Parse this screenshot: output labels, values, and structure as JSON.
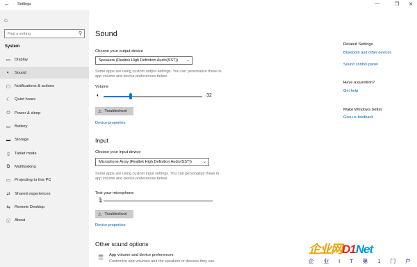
{
  "window": {
    "title": "Settings",
    "minimize": "—",
    "maximize": "❐",
    "close": "✕"
  },
  "sidebar": {
    "search_placeholder": "Find a setting",
    "section_label": "System",
    "items": [
      {
        "label": "Display",
        "icon": "display-icon",
        "glyph": "▭"
      },
      {
        "label": "Sound",
        "icon": "speaker-icon",
        "glyph": "🔈︎"
      },
      {
        "label": "Notifications & actions",
        "icon": "notifications-icon",
        "glyph": "▢"
      },
      {
        "label": "Quiet hours",
        "icon": "moon-icon",
        "glyph": "☾"
      },
      {
        "label": "Power & sleep",
        "icon": "power-icon",
        "glyph": "⏻"
      },
      {
        "label": "Battery",
        "icon": "battery-icon",
        "glyph": "▭"
      },
      {
        "label": "Storage",
        "icon": "storage-icon",
        "glyph": "▬"
      },
      {
        "label": "Tablet mode",
        "icon": "tablet-icon",
        "glyph": "▯"
      },
      {
        "label": "Multitasking",
        "icon": "multitasking-icon",
        "glyph": "⧉"
      },
      {
        "label": "Projecting to this PC",
        "icon": "projecting-icon",
        "glyph": "▭"
      },
      {
        "label": "Shared experiences",
        "icon": "shared-icon",
        "glyph": "⇄"
      },
      {
        "label": "Remote Desktop",
        "icon": "remote-desktop-icon",
        "glyph": "⇆"
      },
      {
        "label": "About",
        "icon": "info-icon",
        "glyph": "ⓘ"
      }
    ],
    "active_index": 1
  },
  "main": {
    "title": "Sound",
    "output": {
      "label": "Choose your output device",
      "device": "Speakers (Realtek High Definition Audio(SST))",
      "desc": "Some apps are using custom output settings. You can personalize these in app volume and device preferences below.",
      "volume_label": "Volume",
      "volume_value": "32",
      "volume_fraction": 0.32,
      "troubleshoot": "Troubleshoot",
      "device_properties": "Device properties"
    },
    "input": {
      "heading": "Input",
      "label": "Choose your input device",
      "device": "Microphone Array (Realtek High Definition Audio(SST))",
      "desc": "Some apps are using custom input settings. You can personalize these in app volume and device preferences below.",
      "test_label": "Test your microphone",
      "troubleshoot": "Troubleshoot",
      "device_properties": "Device properties"
    },
    "other": {
      "heading": "Other sound options",
      "item_title": "App volume and device preferences",
      "item_desc": "Customize app volumes and the speakers or devices they use."
    }
  },
  "related": {
    "heading": "Related Settings",
    "links": [
      "Bluetooth and other devices",
      "Sound control panel"
    ],
    "question_heading": "Have a question?",
    "help_link": "Get help",
    "better_heading": "Make Windows better",
    "feedback_link": "Give us feedback"
  },
  "watermark": {
    "main_a": "企业网",
    "main_b": "D1",
    "main_c": "Net",
    "sub": "企 业 I T 第 1 门 户"
  },
  "colors": {
    "accent": "#0078d7",
    "link": "#0063b1",
    "sidebar_bg": "#f2f2f2"
  }
}
